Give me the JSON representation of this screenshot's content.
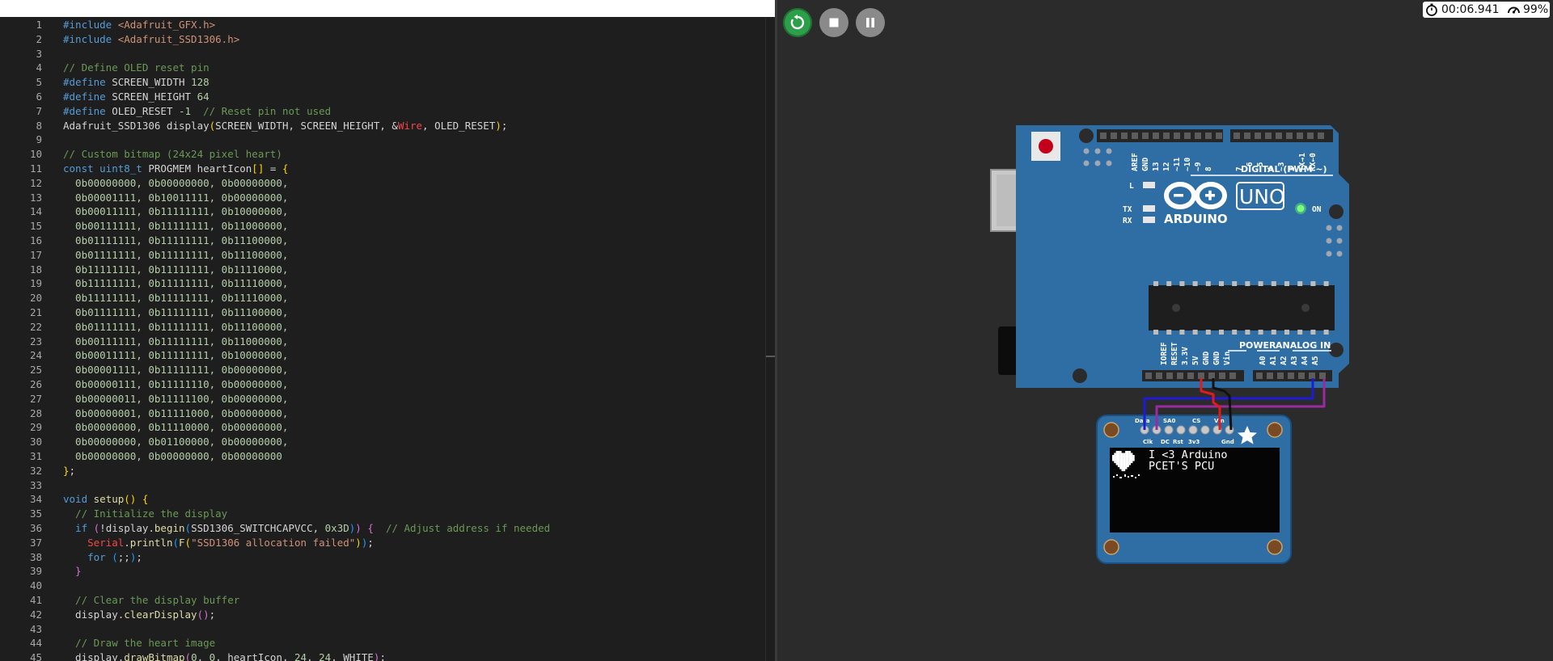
{
  "editor": {
    "lines": [
      {
        "n": "1",
        "t": [
          [
            "kw",
            "#include "
          ],
          [
            "str",
            "<Adafruit_GFX.h>"
          ]
        ]
      },
      {
        "n": "2",
        "t": [
          [
            "kw",
            "#include "
          ],
          [
            "str",
            "<Adafruit_SSD1306.h>"
          ]
        ]
      },
      {
        "n": "3",
        "t": []
      },
      {
        "n": "4",
        "t": [
          [
            "com",
            "// Define OLED reset pin"
          ]
        ]
      },
      {
        "n": "5",
        "t": [
          [
            "kw",
            "#define "
          ],
          [
            "tx",
            "SCREEN_WIDTH "
          ],
          [
            "num",
            "128"
          ]
        ]
      },
      {
        "n": "6",
        "t": [
          [
            "kw",
            "#define "
          ],
          [
            "tx",
            "SCREEN_HEIGHT "
          ],
          [
            "num",
            "64"
          ]
        ]
      },
      {
        "n": "7",
        "t": [
          [
            "kw",
            "#define "
          ],
          [
            "tx",
            "OLED_RESET "
          ],
          [
            "num",
            "-1"
          ],
          [
            "tx",
            "  "
          ],
          [
            "com",
            "// Reset pin not used"
          ]
        ]
      },
      {
        "n": "8",
        "t": [
          [
            "tx",
            "Adafruit_SSD1306 display"
          ],
          [
            "br1",
            "("
          ],
          [
            "tx",
            "SCREEN_WIDTH, SCREEN_HEIGHT, &"
          ],
          [
            "red",
            "Wire"
          ],
          [
            "tx",
            ", OLED_RESET"
          ],
          [
            "br1",
            ")"
          ],
          [
            "tx",
            ";"
          ]
        ]
      },
      {
        "n": "9",
        "t": []
      },
      {
        "n": "10",
        "t": [
          [
            "com",
            "// Custom bitmap (24x24 pixel heart)"
          ]
        ]
      },
      {
        "n": "11",
        "t": [
          [
            "kw",
            "const uint8_t "
          ],
          [
            "tx",
            "PROGMEM heartIcon"
          ],
          [
            "br1",
            "[]"
          ],
          [
            "tx",
            " = "
          ],
          [
            "br1",
            "{"
          ]
        ]
      },
      {
        "n": "12",
        "t": [
          [
            "num",
            "  0b00000000, 0b00000000, 0b00000000,"
          ]
        ]
      },
      {
        "n": "13",
        "t": [
          [
            "num",
            "  0b00001111, 0b10011111, 0b00000000,"
          ]
        ]
      },
      {
        "n": "14",
        "t": [
          [
            "num",
            "  0b00011111, 0b11111111, 0b10000000,"
          ]
        ]
      },
      {
        "n": "15",
        "t": [
          [
            "num",
            "  0b00111111, 0b11111111, 0b11000000,"
          ]
        ]
      },
      {
        "n": "16",
        "t": [
          [
            "num",
            "  0b01111111, 0b11111111, 0b11100000,"
          ]
        ]
      },
      {
        "n": "17",
        "t": [
          [
            "num",
            "  0b01111111, 0b11111111, 0b11100000,"
          ]
        ]
      },
      {
        "n": "18",
        "t": [
          [
            "num",
            "  0b11111111, 0b11111111, 0b11110000,"
          ]
        ]
      },
      {
        "n": "19",
        "t": [
          [
            "num",
            "  0b11111111, 0b11111111, 0b11110000,"
          ]
        ]
      },
      {
        "n": "20",
        "t": [
          [
            "num",
            "  0b11111111, 0b11111111, 0b11110000,"
          ]
        ]
      },
      {
        "n": "21",
        "t": [
          [
            "num",
            "  0b01111111, 0b11111111, 0b11100000,"
          ]
        ]
      },
      {
        "n": "22",
        "t": [
          [
            "num",
            "  0b01111111, 0b11111111, 0b11100000,"
          ]
        ]
      },
      {
        "n": "23",
        "t": [
          [
            "num",
            "  0b00111111, 0b11111111, 0b11000000,"
          ]
        ]
      },
      {
        "n": "24",
        "t": [
          [
            "num",
            "  0b00011111, 0b11111111, 0b10000000,"
          ]
        ]
      },
      {
        "n": "25",
        "t": [
          [
            "num",
            "  0b00001111, 0b11111111, 0b00000000,"
          ]
        ]
      },
      {
        "n": "26",
        "t": [
          [
            "num",
            "  0b00000111, 0b11111110, 0b00000000,"
          ]
        ]
      },
      {
        "n": "27",
        "t": [
          [
            "num",
            "  0b00000011, 0b11111100, 0b00000000,"
          ]
        ]
      },
      {
        "n": "28",
        "t": [
          [
            "num",
            "  0b00000001, 0b11111000, 0b00000000,"
          ]
        ]
      },
      {
        "n": "29",
        "t": [
          [
            "num",
            "  0b00000000, 0b11110000, 0b00000000,"
          ]
        ]
      },
      {
        "n": "30",
        "t": [
          [
            "num",
            "  0b00000000, 0b01100000, 0b00000000,"
          ]
        ]
      },
      {
        "n": "31",
        "t": [
          [
            "num",
            "  0b00000000, 0b00000000, 0b00000000"
          ]
        ]
      },
      {
        "n": "32",
        "t": [
          [
            "br1",
            "}"
          ],
          [
            "tx",
            ";"
          ]
        ]
      },
      {
        "n": "33",
        "t": []
      },
      {
        "n": "34",
        "t": [
          [
            "kw",
            "void "
          ],
          [
            "fn",
            "setup"
          ],
          [
            "br1",
            "()"
          ],
          [
            "tx",
            " "
          ],
          [
            "br1",
            "{"
          ]
        ]
      },
      {
        "n": "35",
        "t": [
          [
            "com",
            "  // Initialize the display"
          ]
        ]
      },
      {
        "n": "36",
        "t": [
          [
            "kw",
            "  if "
          ],
          [
            "br2",
            "("
          ],
          [
            "tx",
            "!display."
          ],
          [
            "fn",
            "begin"
          ],
          [
            "br3",
            "("
          ],
          [
            "tx",
            "SSD1306_SWITCHCAPVCC, "
          ],
          [
            "num",
            "0x3D"
          ],
          [
            "br3",
            ")"
          ],
          [
            "br2",
            ")"
          ],
          [
            "tx",
            " "
          ],
          [
            "br2",
            "{"
          ],
          [
            "tx",
            "  "
          ],
          [
            "com",
            "// Adjust address if needed"
          ]
        ]
      },
      {
        "n": "37",
        "t": [
          [
            "tx",
            "    "
          ],
          [
            "red",
            "Serial"
          ],
          [
            "tx",
            "."
          ],
          [
            "fn",
            "println"
          ],
          [
            "br3",
            "("
          ],
          [
            "fn",
            "F"
          ],
          [
            "br1",
            "("
          ],
          [
            "str",
            "\"SSD1306 allocation failed\""
          ],
          [
            "br1",
            ")"
          ],
          [
            "br3",
            ")"
          ],
          [
            "tx",
            ";"
          ]
        ]
      },
      {
        "n": "38",
        "t": [
          [
            "kw",
            "    for "
          ],
          [
            "br3",
            "("
          ],
          [
            "tx",
            ";;"
          ],
          [
            "br3",
            ")"
          ],
          [
            "tx",
            ";"
          ]
        ]
      },
      {
        "n": "39",
        "t": [
          [
            "br2",
            "  }"
          ]
        ]
      },
      {
        "n": "40",
        "t": []
      },
      {
        "n": "41",
        "t": [
          [
            "com",
            "  // Clear the display buffer"
          ]
        ]
      },
      {
        "n": "42",
        "t": [
          [
            "tx",
            "  display."
          ],
          [
            "fn",
            "clearDisplay"
          ],
          [
            "br2",
            "()"
          ],
          [
            "tx",
            ";"
          ]
        ]
      },
      {
        "n": "43",
        "t": []
      },
      {
        "n": "44",
        "t": [
          [
            "com",
            "  // Draw the heart image"
          ]
        ]
      },
      {
        "n": "45",
        "t": [
          [
            "tx",
            "  display."
          ],
          [
            "fn",
            "drawBitmap"
          ],
          [
            "br2",
            "("
          ],
          [
            "num",
            "0"
          ],
          [
            "tx",
            ", "
          ],
          [
            "num",
            "0"
          ],
          [
            "tx",
            ", heartIcon, "
          ],
          [
            "num",
            "24"
          ],
          [
            "tx",
            ", "
          ],
          [
            "num",
            "24"
          ],
          [
            "tx",
            ", WHITE"
          ],
          [
            "br2",
            ")"
          ],
          [
            "tx",
            ";"
          ]
        ]
      }
    ]
  },
  "toolbar": {
    "restart_icon": "restart-icon",
    "stop_icon": "stop-icon",
    "pause_icon": "pause-icon"
  },
  "status": {
    "timer": "00:06.941",
    "speed": "99%",
    "timer_icon": "stopwatch-icon",
    "speed_icon": "speedometer-icon"
  },
  "arduino": {
    "brand": "ARDUINO",
    "model": "UNO",
    "digital_label": "DIGITAL (PWM ~)",
    "power_label": "POWER",
    "analog_label": "ANALOG IN",
    "on_label": "ON",
    "l_label": "L",
    "tx_label": "TX",
    "rx_label": "RX",
    "digital_pins": [
      "AREF",
      "GND",
      "13",
      "12",
      "~11",
      "~10",
      "~9",
      "8",
      "7",
      "~6",
      "~5",
      "4",
      "~3",
      "2",
      "TX→1",
      "RX←0"
    ],
    "power_pins": [
      "IOREF",
      "RESET",
      "3.3V",
      "5V",
      "GND",
      "GND",
      "Vin"
    ],
    "analog_pins": [
      "A0",
      "A1",
      "A2",
      "A3",
      "A4",
      "A5"
    ]
  },
  "oled": {
    "pin_top_labels": [
      "Data",
      "SA0",
      "CS",
      "Vin"
    ],
    "pin_bottom_labels": [
      "Clk",
      "DC",
      "Rst",
      "3v3",
      "Gnd"
    ],
    "screen_line1": "I <3 Arduino",
    "screen_line2": "PCET'S PCU"
  },
  "colors": {
    "board": "#2f6ea5",
    "run_green": "#2d9e49",
    "wire_blue": "#1c1cd6",
    "wire_purple": "#9a2aa0",
    "wire_red": "#e01b1b",
    "wire_black": "#111111"
  }
}
